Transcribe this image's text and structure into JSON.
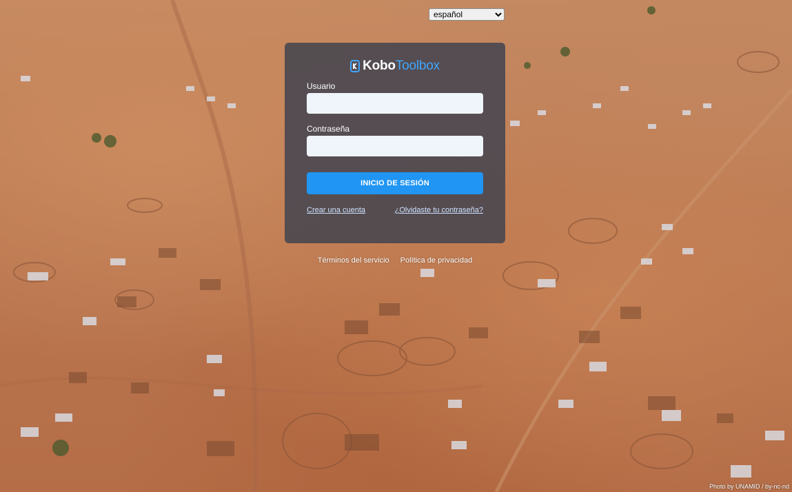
{
  "language_select": {
    "selected": "español",
    "options": [
      "español"
    ]
  },
  "logo": {
    "part1": "Kobo",
    "part2": "Toolbox",
    "icon": "kobo-logo-icon"
  },
  "form": {
    "username_label": "Usuario",
    "username_value": "",
    "password_label": "Contraseña",
    "password_value": "",
    "submit_label": "INICIO DE SESIÓN",
    "create_account": "Crear una cuenta",
    "forgot_password": "¿Olvidaste tu contraseña?"
  },
  "footer": {
    "terms": "Términos del servicio",
    "privacy": "Política de privacidad"
  },
  "photo_credit": "Photo by UNAMID / by-nc-nd",
  "colors": {
    "primary_button": "#2095f3",
    "card_background": "#46464f",
    "logo_accent": "#3fa6ff"
  }
}
